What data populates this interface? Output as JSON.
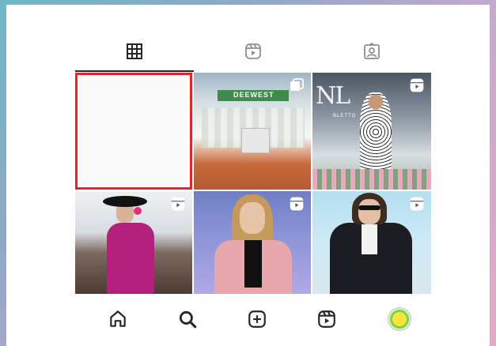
{
  "tabs": [
    {
      "name": "posts",
      "icon": "grid-icon",
      "active": true
    },
    {
      "name": "reels",
      "icon": "reels-icon",
      "active": false
    },
    {
      "name": "tagged",
      "icon": "tagged-icon",
      "active": false
    }
  ],
  "grid": {
    "tiles": [
      {
        "id": "tile-1",
        "selected": true,
        "badge": null
      },
      {
        "id": "tile-2",
        "badge": "carousel-icon",
        "banner_text": "DEEWEST"
      },
      {
        "id": "tile-3",
        "badge": "reels-icon",
        "overlay_text": "NL",
        "overlay_small": "BLETTO"
      },
      {
        "id": "tile-4",
        "badge": "reels-icon"
      },
      {
        "id": "tile-5",
        "badge": "reels-icon"
      },
      {
        "id": "tile-6",
        "badge": "reels-icon"
      }
    ],
    "selection_color": "#e0262b"
  },
  "bottom_nav": [
    {
      "name": "home",
      "icon": "home-icon"
    },
    {
      "name": "search",
      "icon": "search-icon"
    },
    {
      "name": "create",
      "icon": "plus-square-icon"
    },
    {
      "name": "reels",
      "icon": "reels-icon"
    },
    {
      "name": "profile",
      "icon": "avatar"
    }
  ],
  "colors": {
    "icon": "#262626",
    "active_underline": "#262626",
    "background_gradient": [
      "#6fb6c9",
      "#c7a9cf",
      "#e6a9c5"
    ]
  }
}
